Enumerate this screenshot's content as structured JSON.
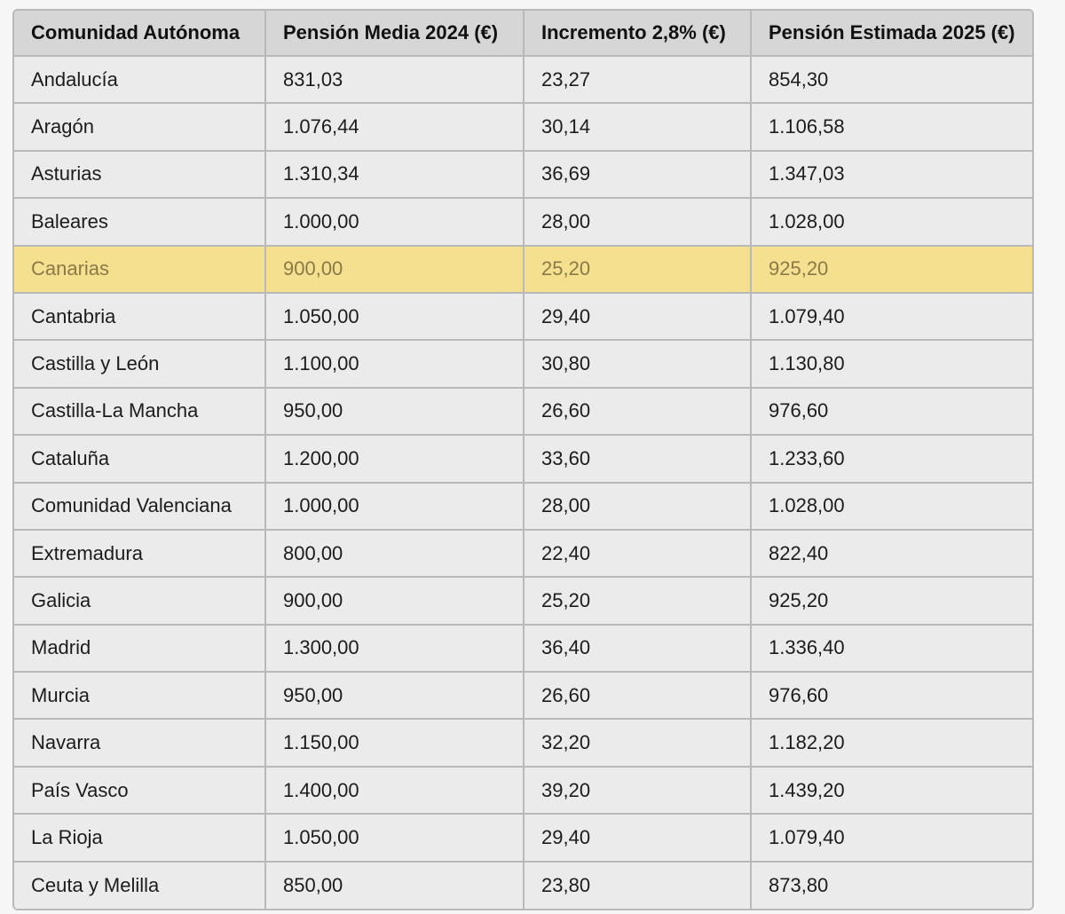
{
  "table": {
    "headers": [
      "Comunidad Autónoma",
      "Pensión Media 2024 (€)",
      "Incremento 2,8% (€)",
      "Pensión Estimada 2025 (€)"
    ],
    "highlight_color": "#f5e08f",
    "highlighted_row": "Canarias",
    "rows": [
      [
        "Andalucía",
        "831,03",
        "23,27",
        "854,30"
      ],
      [
        "Aragón",
        "1.076,44",
        "30,14",
        "1.106,58"
      ],
      [
        "Asturias",
        "1.310,34",
        "36,69",
        "1.347,03"
      ],
      [
        "Baleares",
        "1.000,00",
        "28,00",
        "1.028,00"
      ],
      [
        "Canarias",
        "900,00",
        "25,20",
        "925,20"
      ],
      [
        "Cantabria",
        "1.050,00",
        "29,40",
        "1.079,40"
      ],
      [
        "Castilla y León",
        "1.100,00",
        "30,80",
        "1.130,80"
      ],
      [
        "Castilla-La Mancha",
        "950,00",
        "26,60",
        "976,60"
      ],
      [
        "Cataluña",
        "1.200,00",
        "33,60",
        "1.233,60"
      ],
      [
        "Comunidad Valenciana",
        "1.000,00",
        "28,00",
        "1.028,00"
      ],
      [
        "Extremadura",
        "800,00",
        "22,40",
        "822,40"
      ],
      [
        "Galicia",
        "900,00",
        "25,20",
        "925,20"
      ],
      [
        "Madrid",
        "1.300,00",
        "36,40",
        "1.336,40"
      ],
      [
        "Murcia",
        "950,00",
        "26,60",
        "976,60"
      ],
      [
        "Navarra",
        "1.150,00",
        "32,20",
        "1.182,20"
      ],
      [
        "País Vasco",
        "1.400,00",
        "39,20",
        "1.439,20"
      ],
      [
        "La Rioja",
        "1.050,00",
        "29,40",
        "1.079,40"
      ],
      [
        "Ceuta y Melilla",
        "850,00",
        "23,80",
        "873,80"
      ]
    ]
  }
}
